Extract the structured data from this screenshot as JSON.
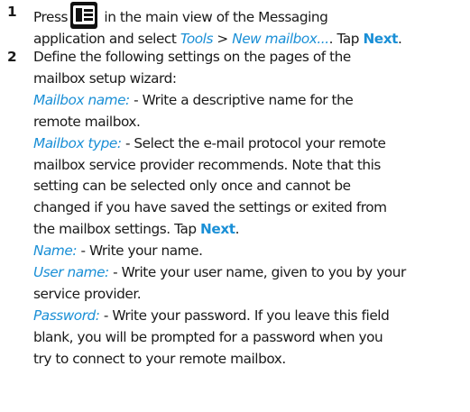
{
  "step1": {
    "number": "1",
    "press": "Press",
    "line1_rest": " in the main view of the Messaging",
    "line2_pre": "application and select ",
    "tools": "Tools",
    "sep": " > ",
    "new_mailbox": "New mailbox...",
    "dot": ". Tap ",
    "next": "Next",
    "end": ".",
    "menu_key_icon": "menu-key-icon"
  },
  "step2": {
    "number": "2",
    "intro1": "Define the following settings on the pages of the",
    "intro2": "mailbox setup wizard:",
    "mailbox_name_label": "Mailbox name:",
    "mailbox_name_desc1": " - Write a descriptive name for the",
    "mailbox_name_desc2": "remote mailbox.",
    "mailbox_type_label": "Mailbox type:",
    "mailbox_type_desc1": " - Select the e-mail protocol your remote",
    "mailbox_type_desc2": "mailbox service provider recommends. Note that this",
    "mailbox_type_desc3": "setting can be selected only once and cannot be",
    "mailbox_type_desc4": "changed if you have saved the settings or exited from",
    "mailbox_type_desc5_pre": "the mailbox settings. Tap ",
    "next": "Next",
    "end": ".",
    "name_label": "Name:",
    "name_desc": " - Write your name.",
    "username_label": "User name:",
    "username_desc1": " - Write your user name, given to you by your",
    "username_desc2": "service provider.",
    "password_label": "Password:",
    "password_desc1": " - Write your password. If you leave this field",
    "password_desc2": "blank, you will be prompted for a password when you",
    "password_desc3": "try to connect to your remote mailbox."
  }
}
